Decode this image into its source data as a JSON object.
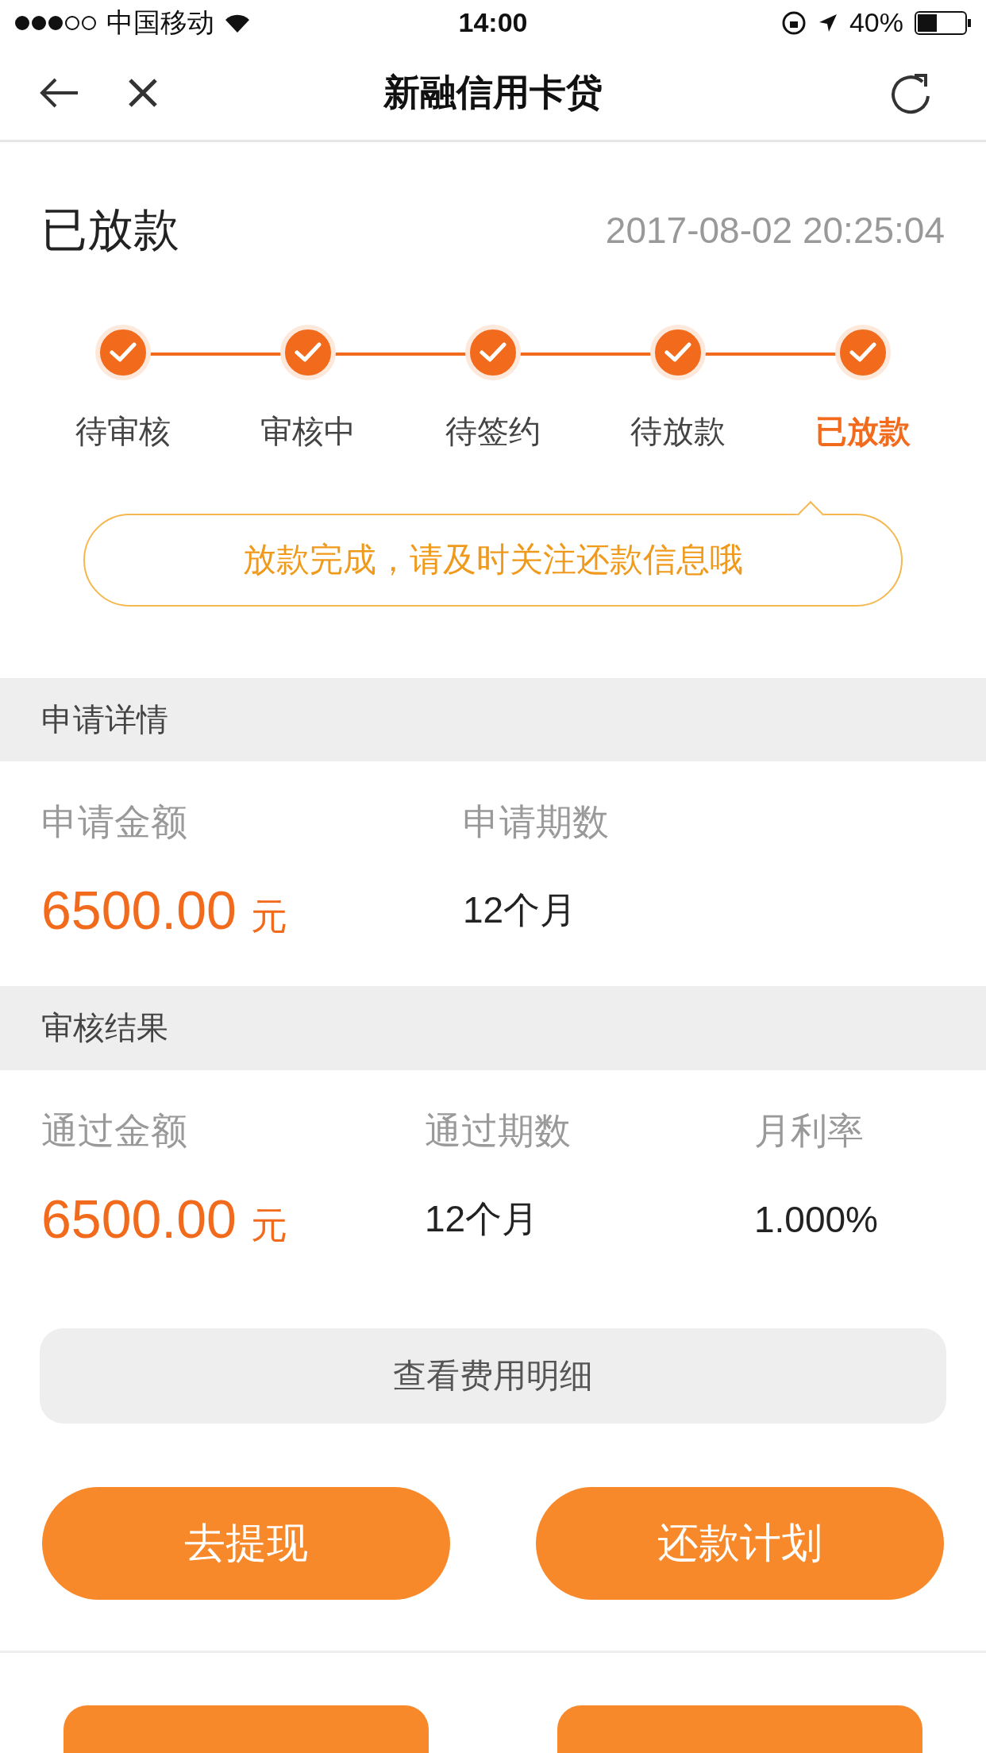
{
  "status_bar": {
    "carrier": "中国移动",
    "time": "14:00",
    "battery": "40%"
  },
  "nav": {
    "title": "新融信用卡贷"
  },
  "status": {
    "title": "已放款",
    "time": "2017-08-02 20:25:04"
  },
  "steps": [
    {
      "label": "待审核",
      "done": true,
      "selected": false
    },
    {
      "label": "审核中",
      "done": true,
      "selected": false
    },
    {
      "label": "待签约",
      "done": true,
      "selected": false
    },
    {
      "label": "待放款",
      "done": true,
      "selected": false
    },
    {
      "label": "已放款",
      "done": true,
      "selected": true
    }
  ],
  "notice": "放款完成，请及时关注还款信息哦",
  "sections": [
    {
      "title": "申请详情",
      "fields": [
        {
          "kind": "amount",
          "label": "申请金额",
          "value": "6500.00",
          "unit": "元"
        },
        {
          "kind": "text",
          "label": "申请期数",
          "value": "12个月"
        }
      ]
    },
    {
      "title": "审核结果",
      "fields": [
        {
          "kind": "amount",
          "label": "通过金额",
          "value": "6500.00",
          "unit": "元"
        },
        {
          "kind": "text",
          "label": "通过期数",
          "value": "12个月"
        },
        {
          "kind": "text",
          "label": "月利率",
          "value": "1.000%"
        }
      ]
    }
  ],
  "fee_button": "查看费用明细",
  "actions": [
    "去提现",
    "还款计划"
  ]
}
